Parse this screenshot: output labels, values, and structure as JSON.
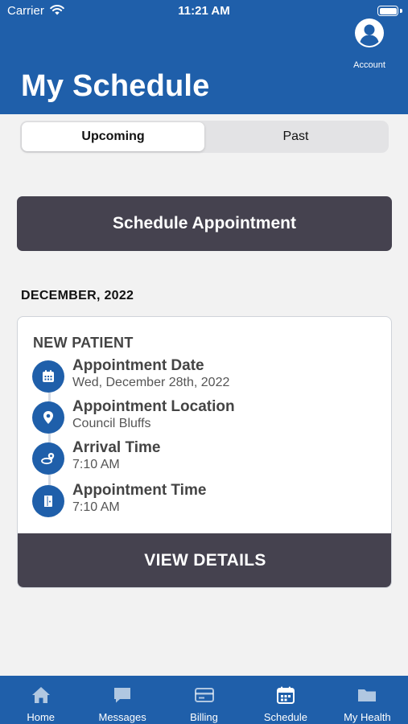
{
  "status_bar": {
    "carrier": "Carrier",
    "time": "11:21 AM"
  },
  "header": {
    "title": "My Schedule",
    "account_label": "Account"
  },
  "segments": [
    {
      "label": "Upcoming",
      "selected": true
    },
    {
      "label": "Past",
      "selected": false
    }
  ],
  "schedule_button_label": "Schedule Appointment",
  "month_heading": "DECEMBER, 2022",
  "appointment": {
    "title": "NEW PATIENT",
    "rows": [
      {
        "icon": "calendar-icon",
        "label": "Appointment Date",
        "value": "Wed, December 28th, 2022"
      },
      {
        "icon": "location-pin-icon",
        "label": "Appointment Location",
        "value": "Council Bluffs"
      },
      {
        "icon": "arrival-icon",
        "label": "Arrival Time",
        "value": "7:10 AM"
      },
      {
        "icon": "door-icon",
        "label": "Appointment Time",
        "value": "7:10 AM"
      }
    ],
    "details_button_label": "VIEW DETAILS"
  },
  "tabbar": {
    "items": [
      {
        "icon": "home-icon",
        "label": "Home"
      },
      {
        "icon": "messages-icon",
        "label": "Messages"
      },
      {
        "icon": "billing-card-icon",
        "label": "Billing"
      },
      {
        "icon": "schedule-calendar-icon",
        "label": "Schedule"
      },
      {
        "icon": "folder-icon",
        "label": "My Health"
      }
    ],
    "active": "Schedule"
  },
  "colors": {
    "brand_blue": "#1f5faa",
    "dark_button": "#45424f",
    "background": "#f2f2f2"
  }
}
